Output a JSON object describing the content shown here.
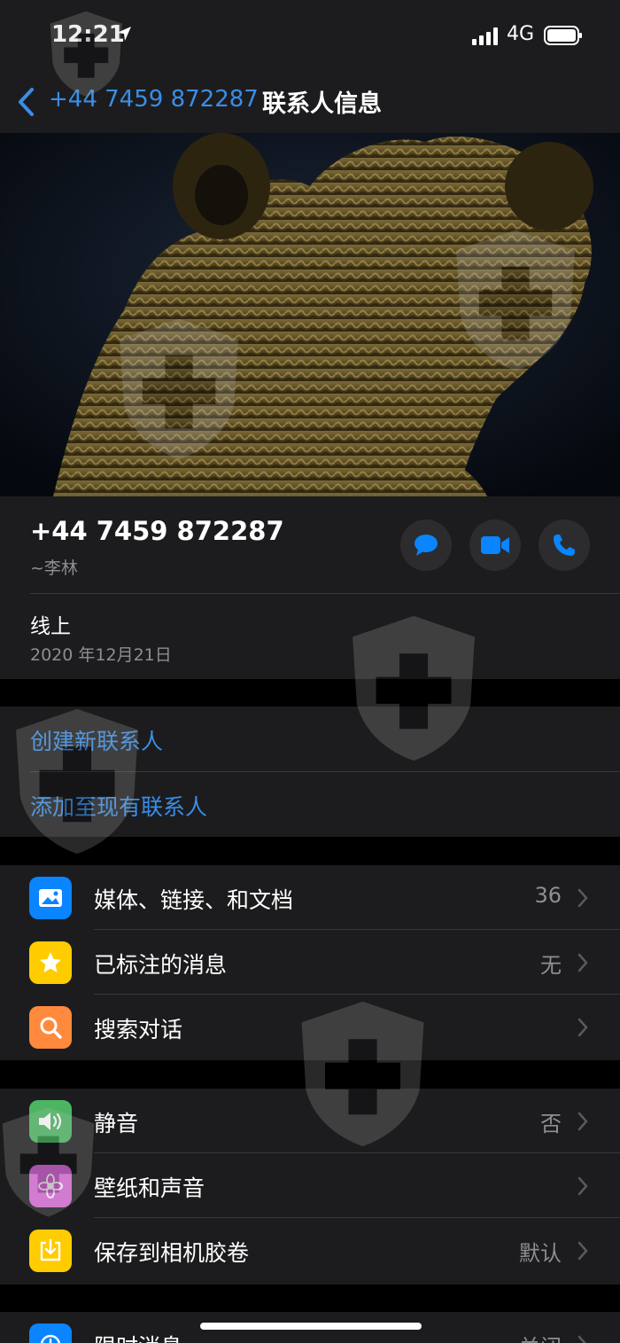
{
  "status_bar": {
    "time": "12:21",
    "network": "4G"
  },
  "nav": {
    "back_label": "+44 7459 872287",
    "title": "联系人信息"
  },
  "contact": {
    "phone": "+44 7459 872287",
    "name": "~李林",
    "status": "线上",
    "date": "2020 年12月21日"
  },
  "actions": {
    "create_contact": "创建新联系人",
    "add_existing": "添加至现有联系人"
  },
  "group1": [
    {
      "label": "媒体、链接、和文档",
      "value": "36",
      "icon": "photo-icon",
      "color": "#0a84ff"
    },
    {
      "label": "已标注的消息",
      "value": "无",
      "icon": "star-icon",
      "color": "#ffcc00"
    },
    {
      "label": "搜索对话",
      "value": "",
      "icon": "search-icon",
      "color": "#ff8a3d"
    }
  ],
  "group2": [
    {
      "label": "静音",
      "value": "否",
      "icon": "speaker-icon",
      "color": "#4cb562"
    },
    {
      "label": "壁纸和声音",
      "value": "",
      "icon": "flower-icon",
      "color": "#d86bd8"
    },
    {
      "label": "保存到相机胶卷",
      "value": "默认",
      "icon": "download-icon",
      "color": "#ffcc00"
    }
  ],
  "group3": [
    {
      "label": "限时消息",
      "value": "关闭",
      "icon": "timer-icon",
      "color": "#0a84ff"
    }
  ],
  "colors": {
    "accent": "#3a8ee6",
    "background": "#000000",
    "panel": "#1c1c1e"
  }
}
